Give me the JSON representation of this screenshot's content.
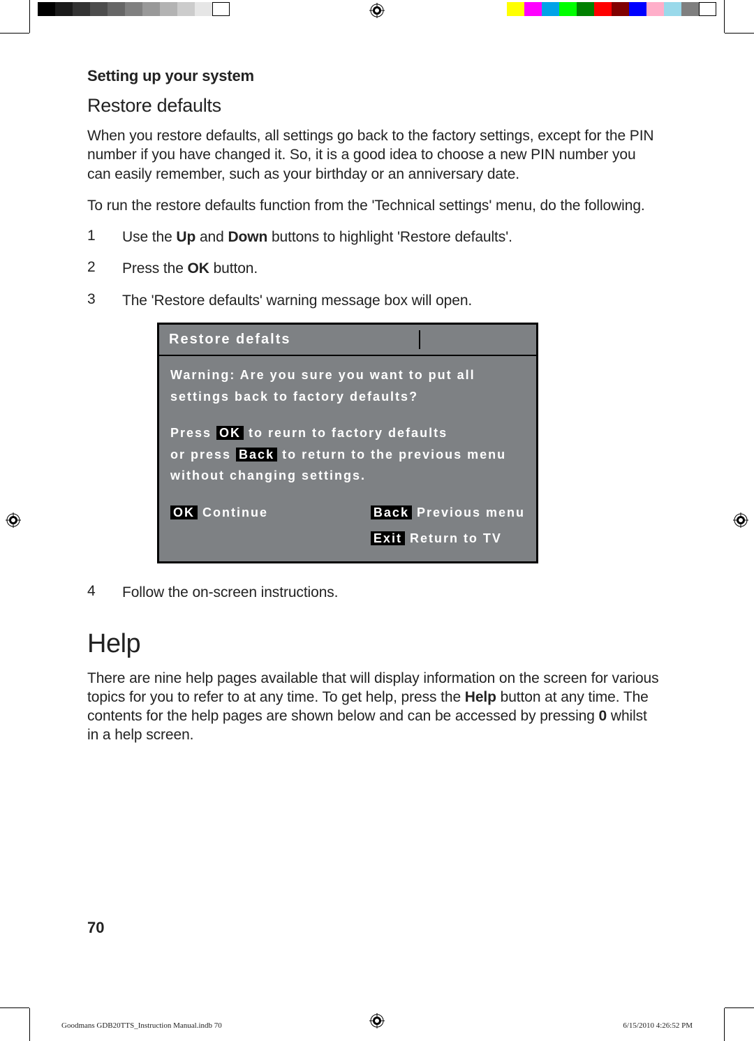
{
  "section_head": "Setting up your system",
  "subhead": "Restore defaults",
  "para1": "When you restore defaults, all settings go back to the factory settings, except for the PIN number if you have changed it. So, it is a  good idea to choose a new PIN number you can easily remember, such as your birthday or an anniversary date.",
  "para2": "To run the restore defaults function from the 'Technical settings' menu, do the following.",
  "steps": [
    {
      "n": "1",
      "pre": "Use the ",
      "b1": "Up",
      "mid": " and ",
      "b2": "Down",
      "post": " buttons to highlight 'Restore defaults'."
    },
    {
      "n": "2",
      "pre": "Press the ",
      "b1": "OK",
      "post": " button."
    },
    {
      "n": "3",
      "text": "The 'Restore defaults' warning message box will open."
    }
  ],
  "step4": {
    "n": "4",
    "text": "Follow the on-screen instructions."
  },
  "h1": "Help",
  "help_para_a": "There are nine help pages available that will display information on the screen for various topics for you to refer to at any time. To get help, press the ",
  "help_b1": "Help",
  "help_para_b": " button at any time. The contents for the help pages are shown below and can be accessed by pressing ",
  "help_b2": "0",
  "help_para_c": " whilst in a help screen.",
  "osd": {
    "title": "Restore defalts",
    "warn": "Warning: Are you sure you want to put all settings back to factory defaults?",
    "l2a": "Press ",
    "l2btn": "OK",
    "l2b": " to reurn to factory defaults",
    "l3a": "or press ",
    "l3btn": "Back",
    "l3b": " to return to the previous menu without changing settings.",
    "ok_btn": "OK",
    "ok_lbl": " Continue",
    "back_btn": "Back",
    "back_lbl": " Previous menu",
    "exit_btn": "Exit",
    "exit_lbl": " Return to TV"
  },
  "page_num": "70",
  "footer_left": "Goodmans GDB20TTS_Instruction Manual.indb   70",
  "footer_right": "6/15/2010   4:26:52 PM",
  "swatches_gray": [
    "#000000",
    "#1a1a1a",
    "#333333",
    "#4d4d4d",
    "#666666",
    "#808080",
    "#999999",
    "#b3b3b3",
    "#cccccc",
    "#e6e6e6",
    "#ffffff"
  ],
  "swatches_color": [
    "#ffff00",
    "#ff00ff",
    "#00a2e8",
    "#00ff00",
    "#008000",
    "#ff0000",
    "#800000",
    "#0000ff",
    "#ffaec9",
    "#99d9ea",
    "#7f7f7f",
    "#ffffff"
  ]
}
